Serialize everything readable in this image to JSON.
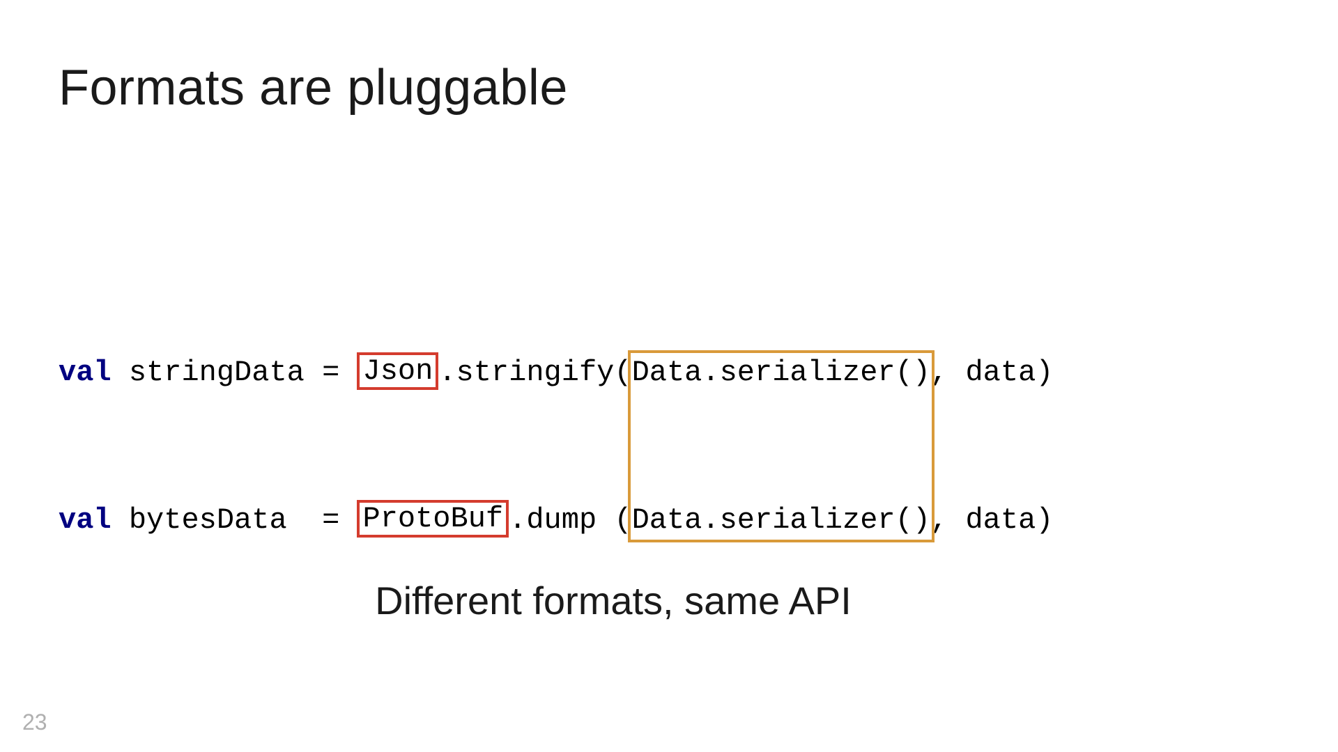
{
  "title": "Formats are\npluggable",
  "code": {
    "line1": {
      "kw": "val",
      "var": " stringData = ",
      "fmt": "Json",
      "mid": ".stringify(",
      "ser": "Data.serializer()",
      "tail": ", data)"
    },
    "line2": {
      "kw": "val",
      "var": " bytesData  = ",
      "fmt": "ProtoBuf",
      "mid": ".dump (",
      "ser": "Data.serializer()",
      "tail": ", data)"
    }
  },
  "subtitle": "Different formats, same API",
  "page": "23",
  "colors": {
    "keyword": "#000080",
    "redBox": "#d43c2e",
    "orangeBox": "#d99a3a"
  }
}
